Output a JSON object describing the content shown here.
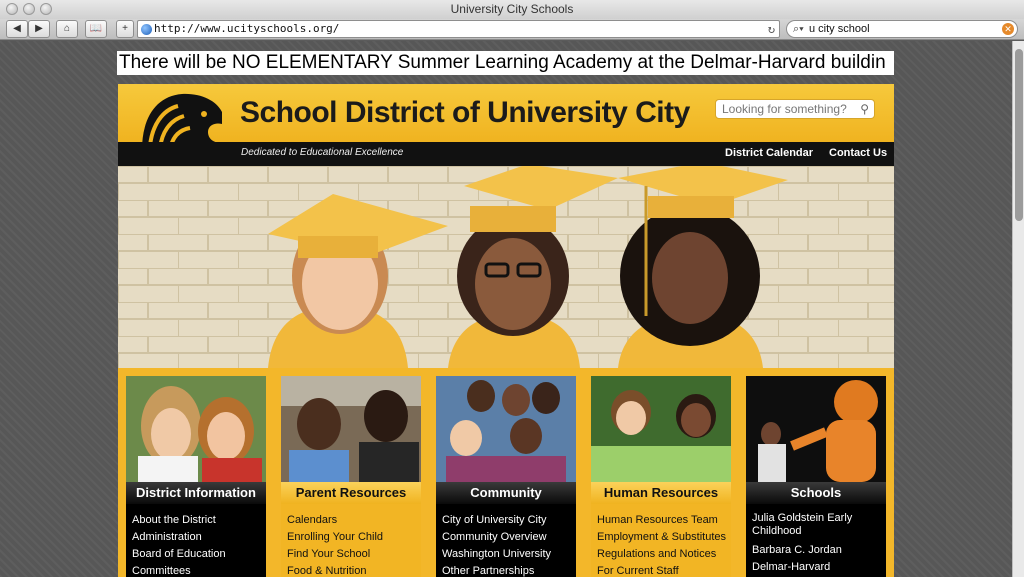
{
  "browser": {
    "window_title": "University City Schools",
    "url": "http://www.ucityschools.org/",
    "search_query": "u city school"
  },
  "announcement": "There will be NO ELEMENTARY Summer Learning Academy at the Delmar-Harvard buildin",
  "header": {
    "site_title": "School District of University City",
    "search_placeholder": "Looking for something?",
    "tagline": "Dedicated to Educational Excellence",
    "nav": [
      "District Calendar",
      "Contact Us"
    ]
  },
  "cards": [
    {
      "title": "District Information",
      "links": [
        "About the District",
        "Administration",
        "Board of Education",
        "Committees"
      ]
    },
    {
      "title": "Parent Resources",
      "links": [
        "Calendars",
        "Enrolling Your Child",
        "Find Your School",
        "Food & Nutrition"
      ]
    },
    {
      "title": "Community",
      "links": [
        "City of University City",
        "Community Overview",
        "Washington University",
        "Other Partnerships"
      ]
    },
    {
      "title": "Human Resources",
      "links": [
        "Human Resources Team",
        "Employment & Substitutes",
        "Regulations and Notices",
        "For Current Staff"
      ]
    },
    {
      "title": "Schools",
      "links": [
        "Julia Goldstein Early Childhood",
        "Barbara C. Jordan",
        "Delmar-Harvard"
      ]
    }
  ],
  "colors": {
    "brand_gold": "#f0b320",
    "brand_black": "#111111"
  }
}
